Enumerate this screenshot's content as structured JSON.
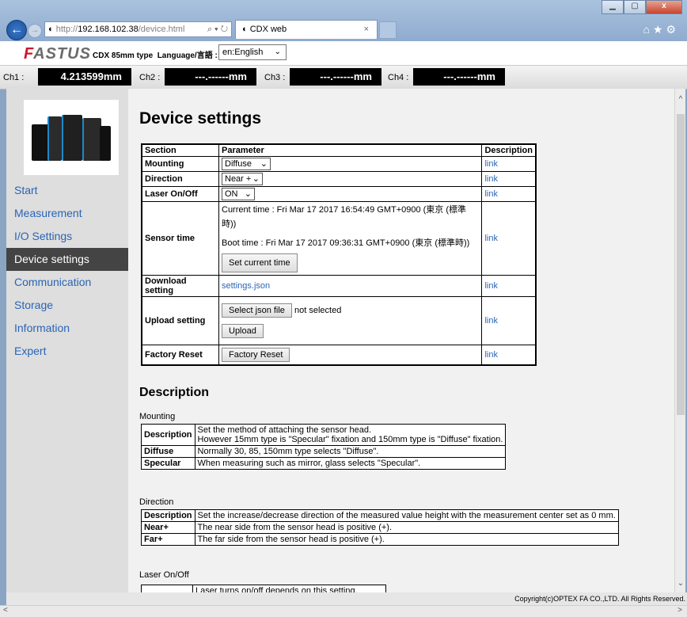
{
  "browser": {
    "url_prefix": "http://",
    "url_host": "192.168.102.38",
    "url_path": "/device.html",
    "tab_title": "CDX web"
  },
  "header": {
    "logo_f": "F",
    "logo_rest": "ASTUS",
    "model": "CDX 85mm type",
    "language_label": "Language/言語 :",
    "language_value": "en:English"
  },
  "channels": [
    {
      "label": "Ch1 :",
      "value": "4.213599mm"
    },
    {
      "label": "Ch2 :",
      "value": "---.------mm"
    },
    {
      "label": "Ch3 :",
      "value": "---.------mm"
    },
    {
      "label": "Ch4 :",
      "value": "---.------mm"
    }
  ],
  "sidebar": {
    "items": [
      {
        "label": "Start"
      },
      {
        "label": "Measurement"
      },
      {
        "label": "I/O Settings"
      },
      {
        "label": "Device settings"
      },
      {
        "label": "Communication"
      },
      {
        "label": "Storage"
      },
      {
        "label": "Information"
      },
      {
        "label": "Expert"
      }
    ]
  },
  "page": {
    "title": "Device settings",
    "headers": {
      "section": "Section",
      "parameter": "Parameter",
      "description": "Description"
    },
    "link_text": "link",
    "mounting": {
      "label": "Mounting",
      "value": "Diffuse"
    },
    "direction": {
      "label": "Direction",
      "value": "Near +"
    },
    "laser": {
      "label": "Laser On/Off",
      "value": "ON"
    },
    "sensor_time": {
      "label": "Sensor time",
      "current": "Current time : Fri Mar 17 2017 16:54:49 GMT+0900 (東京 (標準時))",
      "boot": "Boot time : Fri Mar 17 2017 09:36:31 GMT+0900 (東京 (標準時))",
      "button": "Set current time"
    },
    "download": {
      "label": "Download setting",
      "file": "settings.json"
    },
    "upload": {
      "label": "Upload setting",
      "select_button": "Select json file",
      "status": "not selected",
      "upload_button": "Upload"
    },
    "factory": {
      "label": "Factory Reset",
      "button": "Factory Reset"
    }
  },
  "description": {
    "title": "Description",
    "mounting": {
      "label": "Mounting",
      "rows": [
        {
          "key": "Description",
          "line1": "Set the method of attaching the sensor head.",
          "line2": "However 15mm type is \"Specular\" fixation  and 150mm type is \"Diffuse\" fixation."
        },
        {
          "key": "Diffuse",
          "line1": "Normally 30, 85, 150mm type selects \"Diffuse\"."
        },
        {
          "key": "Specular",
          "line1": "When measuring such as mirror, glass selects \"Specular\"."
        }
      ]
    },
    "direction": {
      "label": "Direction",
      "rows": [
        {
          "key": "Description",
          "line1": "Set the increase/decrease direction of the measured value height with the measurement center set as 0 mm."
        },
        {
          "key": "Near+",
          "line1": "The near side from the sensor head is positive (+)."
        },
        {
          "key": "Far+",
          "line1": "The far side from the sensor head is positive (+)."
        }
      ]
    },
    "laser": {
      "label": "Laser On/Off",
      "partial_row": "Laser turns on/off depends on this setting."
    }
  },
  "footer": {
    "copyright": "Copyright(c)OPTEX FA CO.,LTD. All Rights Reserved."
  }
}
